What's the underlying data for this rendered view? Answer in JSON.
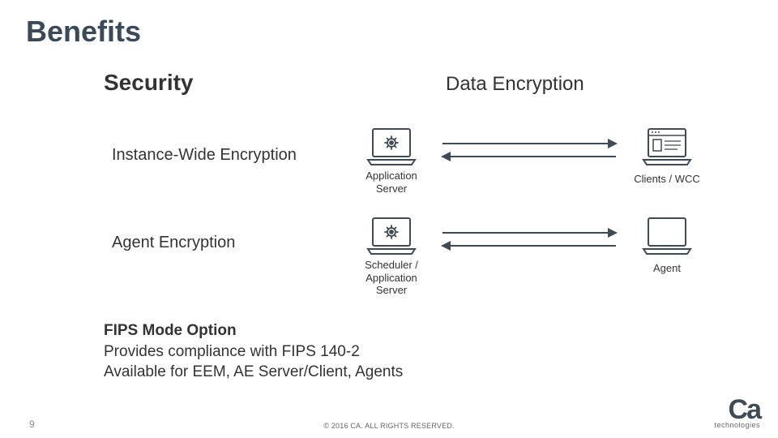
{
  "title": "Benefits",
  "subtitle_left": "Security",
  "subtitle_right": "Data Encryption",
  "rows": [
    {
      "heading": "Instance-Wide Encryption",
      "left_label": "Application Server",
      "right_label": "Clients / WCC",
      "right_icon": "browser"
    },
    {
      "heading": "Agent Encryption",
      "left_label": "Scheduler / Application Server",
      "right_label": "Agent",
      "right_icon": "laptop"
    }
  ],
  "fips": {
    "line1": "FIPS Mode Option",
    "line2": "Provides compliance with FIPS 140-2",
    "line3": "Available for EEM, AE Server/Client, Agents"
  },
  "page_number": "9",
  "copyright": "© 2016 CA. ALL RIGHTS RESERVED.",
  "logo": {
    "main": "Ca",
    "sub": "technologies"
  }
}
